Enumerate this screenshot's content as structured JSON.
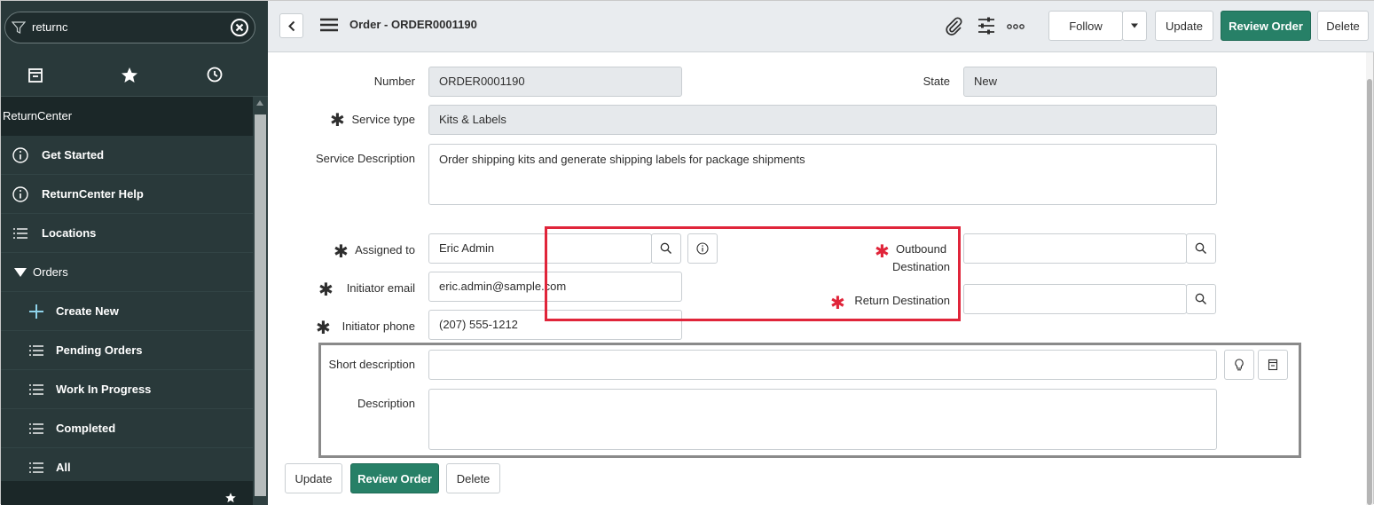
{
  "sidebar": {
    "filter": {
      "value": "returnc"
    },
    "tabs": [
      {
        "icon": "archive-icon"
      },
      {
        "icon": "star-icon"
      },
      {
        "icon": "clock-icon"
      }
    ],
    "app_header": "ReturnCenter",
    "items": [
      {
        "label": "Get Started",
        "icon": "info-icon"
      },
      {
        "label": "ReturnCenter Help",
        "icon": "info-icon"
      },
      {
        "label": "Locations",
        "icon": "list-icon"
      },
      {
        "label": "Orders",
        "icon": "triangle-down-icon"
      },
      {
        "label": "Create New",
        "icon": "plus-icon"
      },
      {
        "label": "Pending Orders",
        "icon": "list-icon"
      },
      {
        "label": "Work In Progress",
        "icon": "list-icon"
      },
      {
        "label": "Completed",
        "icon": "list-icon"
      },
      {
        "label": "All",
        "icon": "list-icon"
      }
    ]
  },
  "header": {
    "title": "Order - ORDER0001190",
    "follow_label": "Follow",
    "update_label": "Update",
    "review_label": "Review Order",
    "delete_label": "Delete"
  },
  "form": {
    "number": {
      "label": "Number",
      "value": "ORDER0001190"
    },
    "state": {
      "label": "State",
      "value": "New"
    },
    "service_type": {
      "label": "Service type",
      "value": "Kits & Labels"
    },
    "service_description": {
      "label": "Service Description",
      "value": "Order shipping kits and generate shipping labels for package shipments"
    },
    "assigned_to": {
      "label": "Assigned to",
      "value": "Eric Admin"
    },
    "initiator_email": {
      "label": "Initiator email",
      "value": "eric.admin@sample.com"
    },
    "initiator_phone": {
      "label": "Initiator phone",
      "value": "(207) 555-1212"
    },
    "outbound_destination": {
      "label_line1": "Outbound",
      "label_line2": "Destination",
      "value": ""
    },
    "return_destination": {
      "label": "Return Destination",
      "value": ""
    },
    "short_description": {
      "label": "Short description",
      "value": ""
    },
    "description": {
      "label": "Description",
      "value": ""
    }
  },
  "footer": {
    "update_label": "Update",
    "review_label": "Review Order",
    "delete_label": "Delete"
  },
  "colors": {
    "sidebar_bg": "#29393a",
    "primary": "#278067",
    "required_red": "#e0253a",
    "highlight_red": "#e0253a",
    "highlight_gray": "#8a8a8a"
  }
}
